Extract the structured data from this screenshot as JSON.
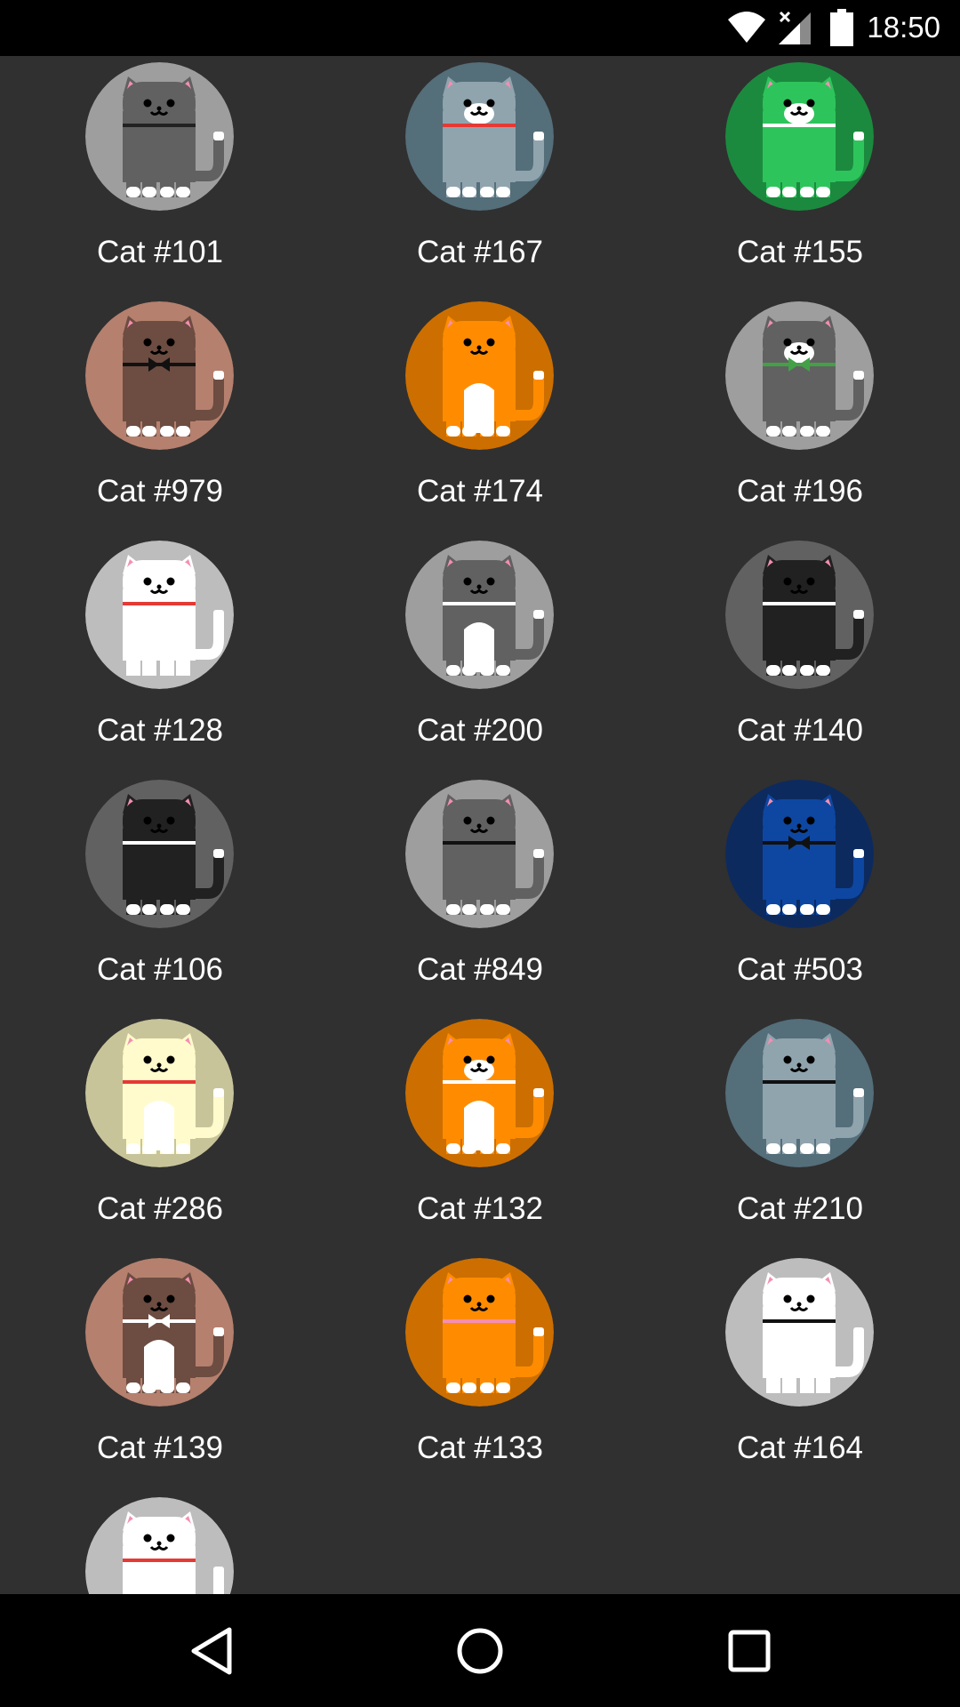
{
  "status_bar": {
    "time": "18:50",
    "icons": [
      "wifi-icon",
      "cell-signal-icon",
      "battery-icon"
    ]
  },
  "cats": [
    {
      "label": "Cat #101",
      "colors": {
        "bg": "#9e9e9e",
        "body": "#616161",
        "belly": null,
        "collar": "#222222",
        "bowtie": null,
        "face": null
      }
    },
    {
      "label": "Cat #167",
      "colors": {
        "bg": "#546e7a",
        "body": "#90a4ae",
        "belly": null,
        "collar": "#e53935",
        "bowtie": null,
        "face": "#ffffff"
      }
    },
    {
      "label": "Cat #155",
      "colors": {
        "bg": "#1b8a3e",
        "body": "#2ec45c",
        "belly": null,
        "collar": "#ffffff",
        "bowtie": null,
        "face": "#ffffff"
      }
    },
    {
      "label": "Cat #979",
      "colors": {
        "bg": "#b5806e",
        "body": "#6d4c41",
        "belly": null,
        "collar": "#111111",
        "bowtie": "#111111",
        "face": null
      }
    },
    {
      "label": "Cat #174",
      "colors": {
        "bg": "#cc6f00",
        "body": "#ff8c00",
        "belly": "#ffffff",
        "collar": null,
        "bowtie": null,
        "face": null
      }
    },
    {
      "label": "Cat #196",
      "colors": {
        "bg": "#9e9e9e",
        "body": "#616161",
        "belly": null,
        "collar": "#43a047",
        "bowtie": "#43a047",
        "face": "#ffffff"
      }
    },
    {
      "label": "Cat #128",
      "colors": {
        "bg": "#bdbdbd",
        "body": "#ffffff",
        "belly": null,
        "collar": "#e53935",
        "bowtie": null,
        "face": null
      }
    },
    {
      "label": "Cat #200",
      "colors": {
        "bg": "#9e9e9e",
        "body": "#616161",
        "belly": "#ffffff",
        "collar": "#ffffff",
        "bowtie": null,
        "face": null
      }
    },
    {
      "label": "Cat #140",
      "colors": {
        "bg": "#616161",
        "body": "#212121",
        "belly": null,
        "collar": "#ffffff",
        "bowtie": null,
        "face": null
      }
    },
    {
      "label": "Cat #106",
      "colors": {
        "bg": "#616161",
        "body": "#212121",
        "belly": null,
        "collar": "#ffffff",
        "bowtie": null,
        "face": null
      }
    },
    {
      "label": "Cat #849",
      "colors": {
        "bg": "#9e9e9e",
        "body": "#616161",
        "belly": null,
        "collar": "#111111",
        "bowtie": null,
        "face": null
      }
    },
    {
      "label": "Cat #503",
      "colors": {
        "bg": "#0d2a5e",
        "body": "#0d47a1",
        "belly": null,
        "collar": "#111111",
        "bowtie": "#111111",
        "face": null
      }
    },
    {
      "label": "Cat #286",
      "colors": {
        "bg": "#c8c49a",
        "body": "#fffbcc",
        "belly": "#ffffff",
        "collar": "#e53935",
        "bowtie": null,
        "face": null
      }
    },
    {
      "label": "Cat #132",
      "colors": {
        "bg": "#cc6f00",
        "body": "#ff8c00",
        "belly": "#ffffff",
        "collar": "#ffffff",
        "bowtie": null,
        "face": "#ffffff"
      }
    },
    {
      "label": "Cat #210",
      "colors": {
        "bg": "#546e7a",
        "body": "#90a4ae",
        "belly": null,
        "collar": "#111111",
        "bowtie": null,
        "face": null
      }
    },
    {
      "label": "Cat #139",
      "colors": {
        "bg": "#b5806e",
        "body": "#6d4c41",
        "belly": "#ffffff",
        "collar": "#ffffff",
        "bowtie": "#ffffff",
        "face": null
      }
    },
    {
      "label": "Cat #133",
      "colors": {
        "bg": "#cc6f00",
        "body": "#ff8c00",
        "belly": null,
        "collar": "#f48fb1",
        "bowtie": null,
        "face": null
      }
    },
    {
      "label": "Cat #164",
      "colors": {
        "bg": "#bdbdbd",
        "body": "#ffffff",
        "belly": null,
        "collar": "#111111",
        "bowtie": null,
        "face": null
      }
    },
    {
      "label": "",
      "colors": {
        "bg": "#bdbdbd",
        "body": "#ffffff",
        "belly": null,
        "collar": "#e53935",
        "bowtie": null,
        "face": null
      }
    }
  ],
  "nav_bar": {
    "buttons": [
      "back-icon",
      "home-icon",
      "recents-icon"
    ]
  }
}
